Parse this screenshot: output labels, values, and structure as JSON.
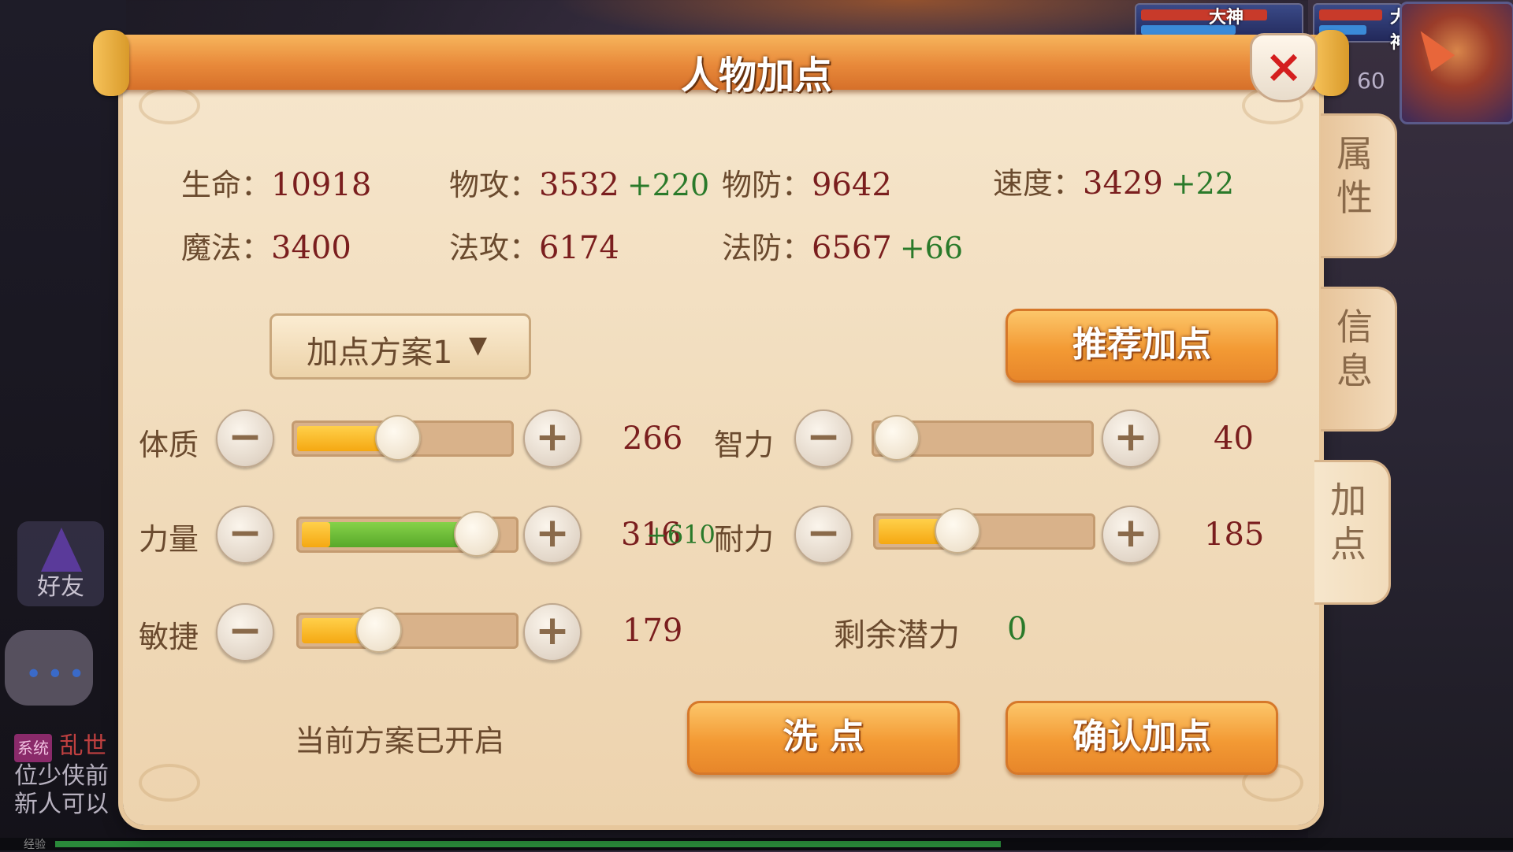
{
  "window": {
    "title": "人物加点",
    "close_label": "×"
  },
  "side_tabs": [
    {
      "label": "属性",
      "active": false
    },
    {
      "label": "信息",
      "active": false
    },
    {
      "label": "加点",
      "active": true
    }
  ],
  "stats": {
    "hp": {
      "label": "生命：",
      "value": "10918",
      "bonus": ""
    },
    "phys_atk": {
      "label": "物攻：",
      "value": "3532",
      "bonus": "+220"
    },
    "phys_def": {
      "label": "物防：",
      "value": "9642",
      "bonus": ""
    },
    "speed": {
      "label": "速度：",
      "value": "3429",
      "bonus": "+22"
    },
    "mp": {
      "label": "魔法：",
      "value": "3400",
      "bonus": ""
    },
    "mag_atk": {
      "label": "法攻：",
      "value": "6174",
      "bonus": ""
    },
    "mag_def": {
      "label": "法防：",
      "value": "6567",
      "bonus": "+66"
    }
  },
  "plan_dropdown": {
    "label": "加点方案1",
    "arrow": "▼"
  },
  "buttons": {
    "recommend": "推荐加点",
    "reset": "洗  点",
    "confirm": "确认加点"
  },
  "attributes": {
    "constitution": {
      "label": "体质",
      "value": "266",
      "bonus": "",
      "level": 0.48
    },
    "intelligence": {
      "label": "智力",
      "value": "40",
      "bonus": "",
      "level": 0.0
    },
    "strength": {
      "label": "力量",
      "value": "316",
      "bonus": "+610",
      "level": 0.92
    },
    "endurance": {
      "label": "耐力",
      "value": "185",
      "bonus": "",
      "level": 0.35
    },
    "agility": {
      "label": "敏捷",
      "value": "179",
      "bonus": "",
      "level": 0.34
    }
  },
  "controls": {
    "minus": "−",
    "plus": "+"
  },
  "remaining": {
    "label": "剩余潜力",
    "value": "0"
  },
  "status_text": "当前方案已开启",
  "background": {
    "hud_tags": [
      "大神",
      "大神"
    ],
    "level": "60",
    "friend_label": "好友",
    "chat_dots": "•••",
    "chat_lines": [
      "位少侠前",
      "新人可以"
    ],
    "chat_sys_tag": "系统",
    "chat_sys_text": "乱世",
    "exp_label": "经验"
  },
  "colors": {
    "accent_orange": "#f39a34",
    "value_red": "#7a1e1e",
    "bonus_green": "#2a7a2a",
    "panel_bg": "#f3e0c2"
  }
}
